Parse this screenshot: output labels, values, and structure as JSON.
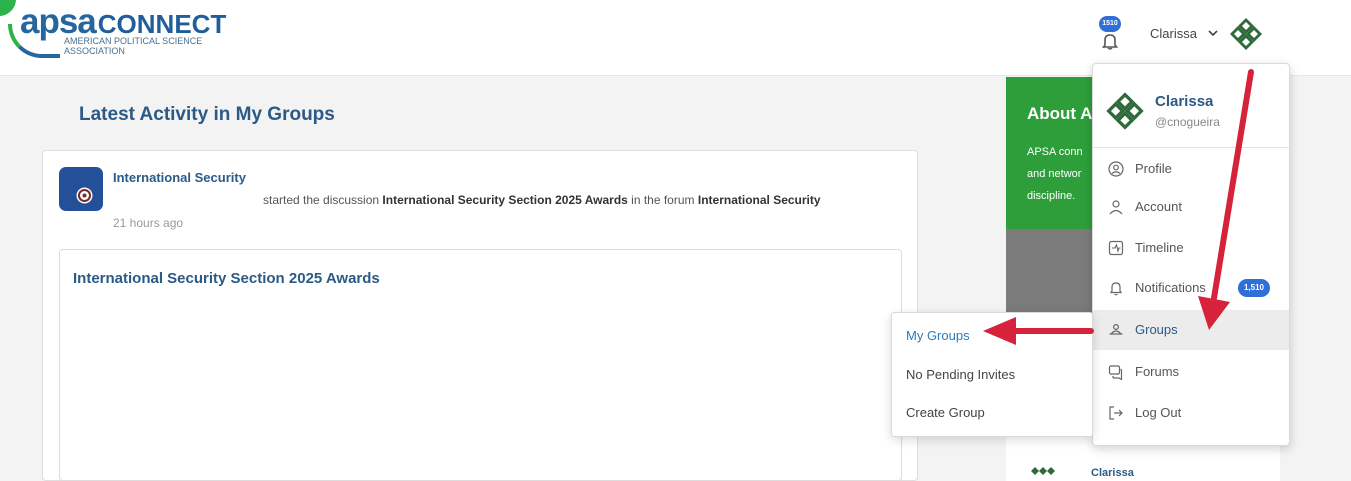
{
  "header": {
    "logo": {
      "brand": "apsa",
      "word": "CONNECT",
      "subtitle": "AMERICAN POLITICAL SCIENCE ASSOCIATION"
    },
    "notification_badge": "1510",
    "user_name": "Clarissa"
  },
  "main": {
    "title": "Latest Activity in My Groups",
    "activity": {
      "group_name": "International Security",
      "text_prefix": "started the discussion ",
      "discussion_link": "International Security Section 2025 Awards",
      "text_middle": " in the forum ",
      "forum_link": "International Security",
      "time": "21 hours ago",
      "discussion_title": "International Security Section 2025 Awards"
    }
  },
  "sidebar": {
    "title": "About A",
    "description_lines": [
      "APSA conn",
      "and networ",
      "discipline."
    ],
    "member_name": "Clarissa"
  },
  "dropdown": {
    "name": "Clarissa",
    "handle": "@cnogueira",
    "items": [
      {
        "label": "Profile",
        "icon": "user-circle-icon"
      },
      {
        "label": "Account",
        "icon": "person-icon"
      },
      {
        "label": "Timeline",
        "icon": "timeline-icon"
      },
      {
        "label": "Notifications",
        "icon": "bell-icon",
        "badge": "1,510"
      },
      {
        "label": "Groups",
        "icon": "groups-icon",
        "active": true
      },
      {
        "label": "Forums",
        "icon": "forums-icon"
      },
      {
        "label": "Log Out",
        "icon": "logout-icon"
      }
    ]
  },
  "submenu": {
    "items": [
      {
        "label": "My Groups",
        "active": true
      },
      {
        "label": "No Pending Invites"
      },
      {
        "label": "Create Group"
      }
    ]
  },
  "colors": {
    "brand_blue": "#2b5a86",
    "green": "#2e9e3b",
    "arrow_red": "#d6223a",
    "badge_blue": "#2f6fd6"
  }
}
